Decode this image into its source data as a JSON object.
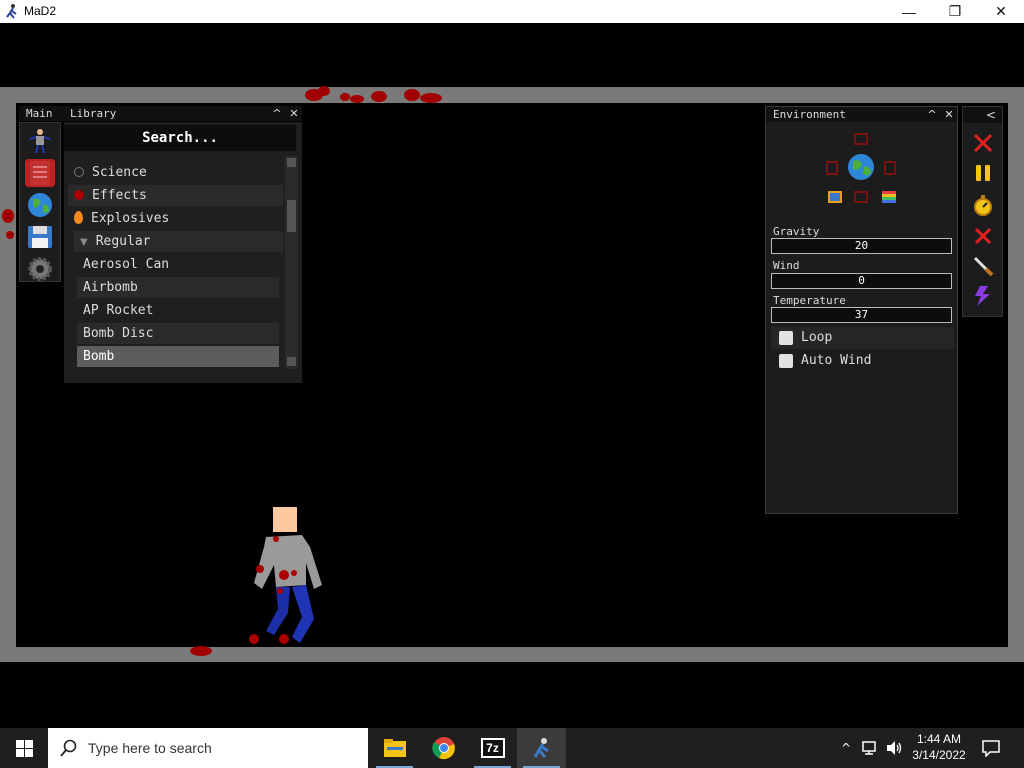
{
  "window": {
    "title": "MaD2",
    "minimize": "—",
    "maximize": "❐",
    "close": "✕"
  },
  "left_panel": {
    "tabs": [
      "Main",
      "Library"
    ],
    "collapse": "^",
    "close": "✕",
    "search_placeholder": "Search...",
    "sidebar_icons": [
      "ragdoll-icon",
      "book-icon",
      "globe-icon",
      "floppy-icon",
      "gear-icon"
    ],
    "items": [
      {
        "label": "Science",
        "icon": "atom-icon"
      },
      {
        "label": "Effects",
        "icon": "effects-icon"
      },
      {
        "label": "Explosives",
        "icon": "fire-icon"
      },
      {
        "label": "Regular",
        "icon": "triangle-down-icon"
      },
      {
        "label": "Aerosol Can"
      },
      {
        "label": "Airbomb"
      },
      {
        "label": "AP Rocket"
      },
      {
        "label": "Bomb Disc"
      },
      {
        "label": "Bomb"
      }
    ],
    "selected": "Bomb"
  },
  "environment": {
    "title": "Environment",
    "collapse": "^",
    "close": "✕",
    "gravity_label": "Gravity",
    "gravity_value": "20",
    "wind_label": "Wind",
    "wind_value": "0",
    "temperature_label": "Temperature",
    "temperature_value": "37",
    "loop_label": "Loop",
    "loop_checked": false,
    "autowind_label": "Auto Wind",
    "autowind_checked": false
  },
  "tools": {
    "toggle": "<",
    "icons": [
      "red-x-icon",
      "pause-icon",
      "stopwatch-icon",
      "red-x-small-icon",
      "knife-icon",
      "lightning-icon"
    ]
  },
  "taskbar": {
    "search_placeholder": "Type here to search",
    "apps": [
      "file-explorer-icon",
      "chrome-icon",
      "7zip-icon",
      "mad2-icon"
    ],
    "time": "1:44 AM",
    "date": "3/14/2022",
    "sevenzip_label": "7z"
  }
}
